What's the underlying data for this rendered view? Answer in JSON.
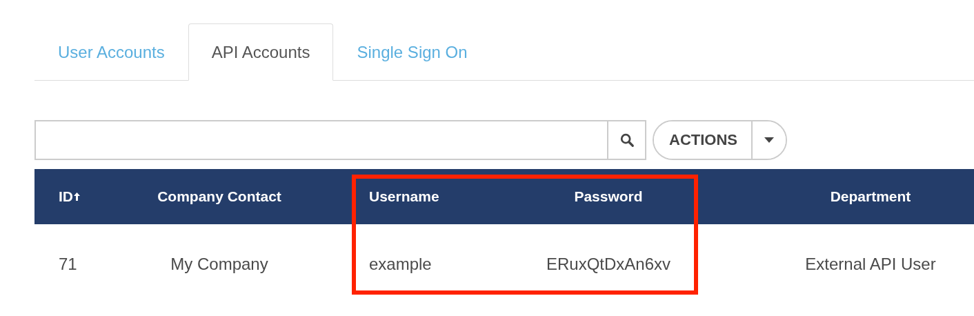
{
  "tabs": [
    {
      "label": "User Accounts",
      "selected": false
    },
    {
      "label": "API Accounts",
      "selected": true
    },
    {
      "label": "Single Sign On",
      "selected": false
    }
  ],
  "toolbar": {
    "actions_button": {
      "label": "ACTIONS"
    }
  },
  "table": {
    "columns": [
      {
        "label": "ID",
        "sorted_ascending": true,
        "highlighted": false
      },
      {
        "label": "Company Contact",
        "sorted_ascending": false,
        "highlighted": false
      },
      {
        "label": "Username",
        "sorted_ascending": false,
        "highlighted": true
      },
      {
        "label": "Password",
        "sorted_ascending": false,
        "highlighted": true
      },
      {
        "label": "Department",
        "sorted_ascending": false,
        "highlighted": false
      }
    ],
    "rows": [
      [
        "71",
        "My Company",
        "example",
        "ERuxQtDxAn6xv",
        "External API User"
      ]
    ]
  }
}
